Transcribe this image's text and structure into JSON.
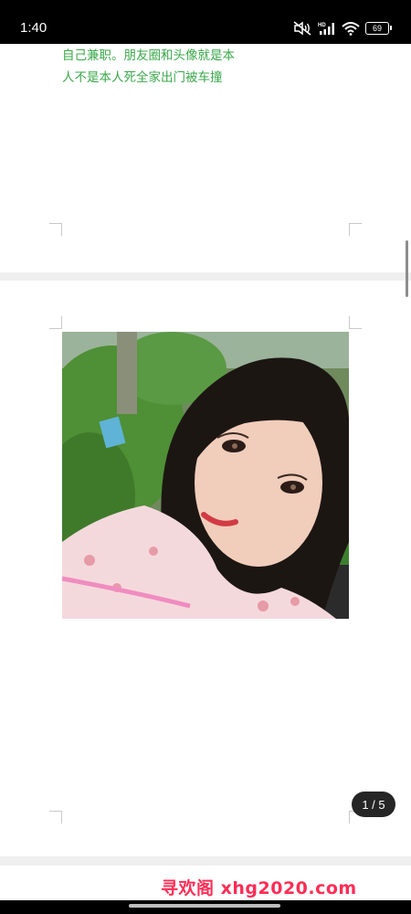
{
  "status_bar": {
    "time": "1:40",
    "battery": "69",
    "icons": [
      "mute-icon",
      "hd-signal-icon",
      "wifi-icon",
      "battery-icon"
    ]
  },
  "document": {
    "text_lines": [
      "自己兼职。朋友圈和头像就是本",
      "人不是本人死全家出门被车撞"
    ],
    "text_color": "#3aa84a",
    "image": "photo-icon"
  },
  "pager": {
    "label": "1 / 5"
  },
  "watermark": {
    "text": "寻欢阁 xhg2020.com",
    "color": "#ff2d55"
  }
}
